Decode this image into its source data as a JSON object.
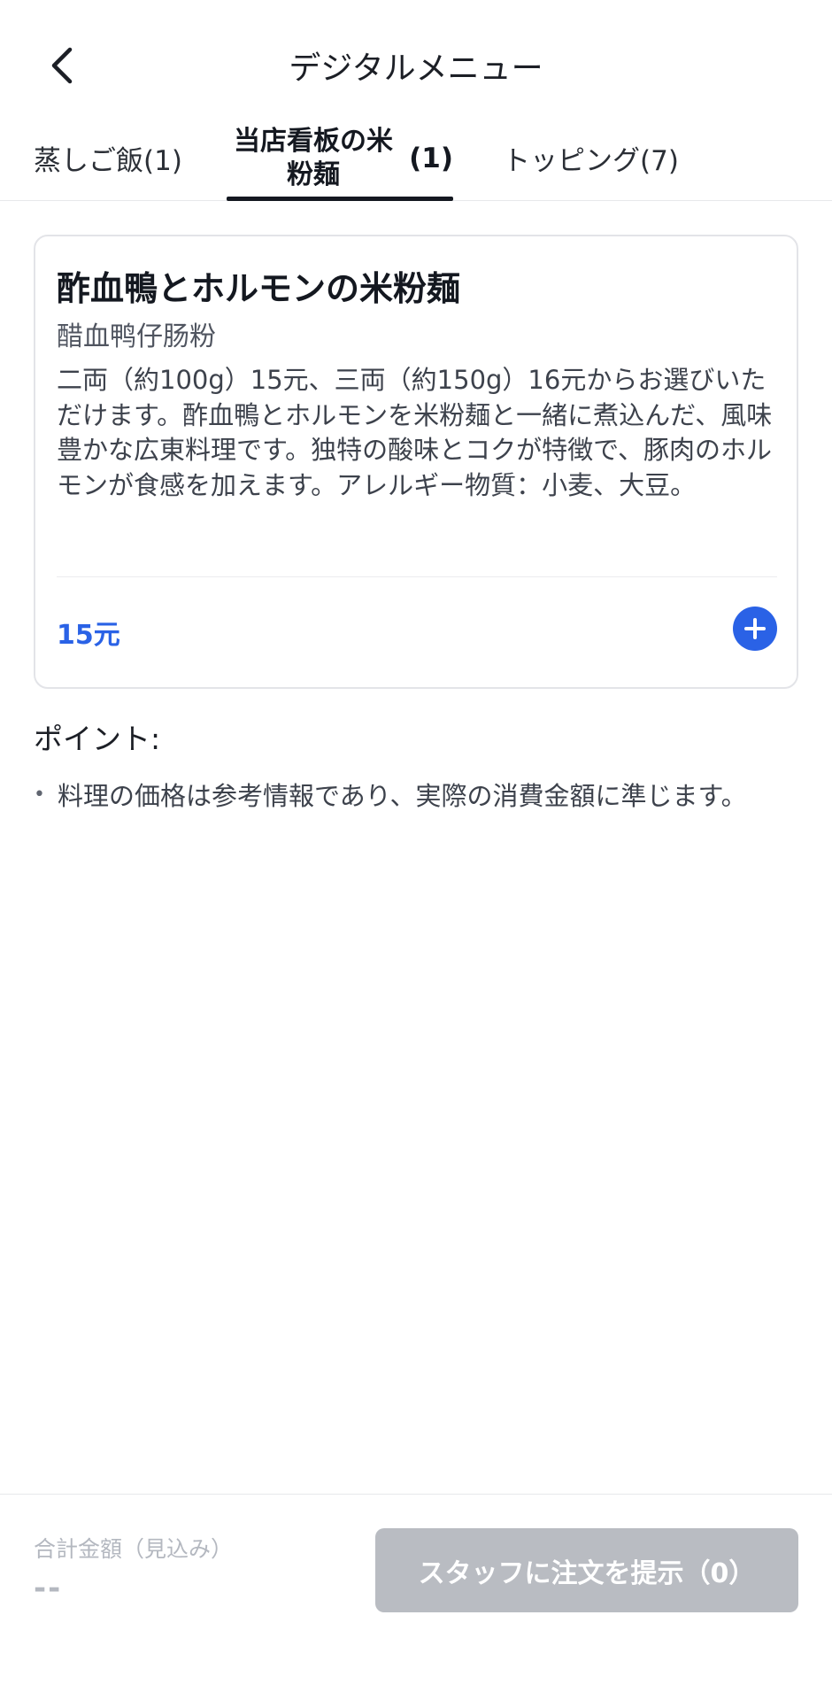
{
  "header": {
    "title": "デジタルメニュー",
    "back_icon": "chevron-left-icon"
  },
  "tabs": [
    {
      "label": "蒸しご飯(1)",
      "active": false
    },
    {
      "label": "当店看板の米粉麺",
      "count": "(1)",
      "active": true
    },
    {
      "label": "トッピング(7)",
      "active": false
    }
  ],
  "dish": {
    "name": "酢血鴨とホルモンの米粉麺",
    "alt_name": "醋血鸭仔肠粉",
    "description": "二両（約100g）15元、三両（約150g）16元からお選びいただけます。酢血鴨とホルモンを米粉麺と一緒に煮込んだ、風味豊かな広東料理です。独特の酸味とコクが特徴で、豚肉のホルモンが食感を加えます。アレルギー物質：小麦、大豆。",
    "price": "15元",
    "add_icon": "plus-icon"
  },
  "notes": {
    "title": "ポイント:",
    "items": [
      "料理の価格は参考情報であり、実際の消費金額に準じます。"
    ]
  },
  "footer": {
    "total_label": "合計金額（見込み）",
    "total_value": "--",
    "submit_label": "スタッフに注文を提示（0）"
  },
  "colors": {
    "accent": "#2a62e6",
    "disabled_button": "#b9bcc2",
    "muted_text": "#b4b8c0"
  }
}
